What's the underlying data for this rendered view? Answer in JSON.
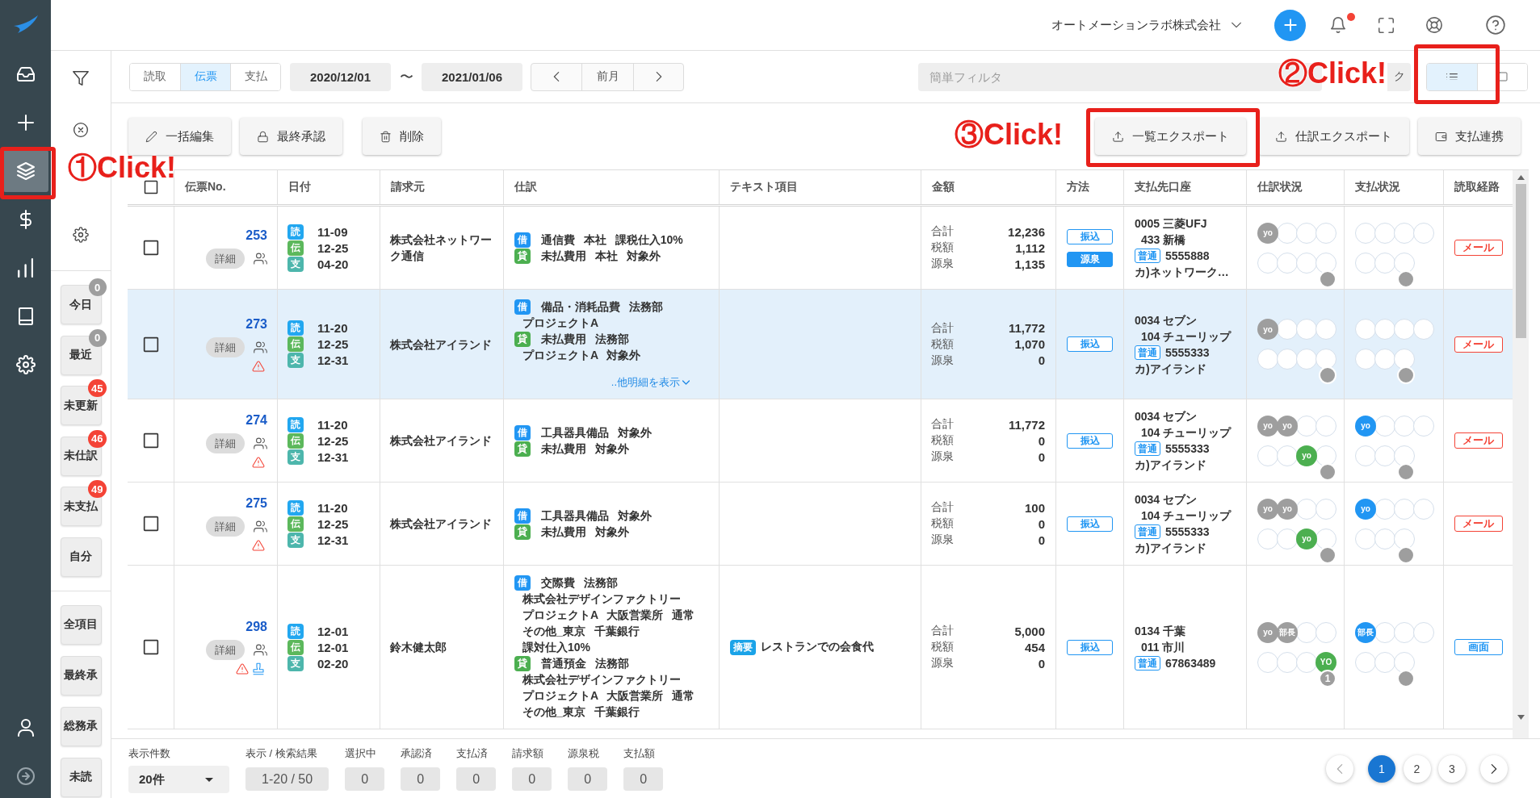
{
  "app_rail": {
    "items": [
      {
        "selected": false
      },
      {
        "selected": false
      },
      {
        "selected": true
      },
      {
        "selected": false
      },
      {
        "selected": false
      },
      {
        "selected": false
      },
      {
        "selected": false
      }
    ]
  },
  "header": {
    "company": "オートメーションラボ株式会社",
    "notifications_unread": true
  },
  "filter_panel": {
    "quick_filters": [
      {
        "label": "今日",
        "badge": {
          "text": "0",
          "color": "#9e9e9e"
        }
      },
      {
        "label": "最近",
        "badge": {
          "text": "0",
          "color": "#9e9e9e"
        }
      },
      {
        "label": "未更新",
        "badge": {
          "text": "45",
          "color": "#f44336"
        }
      },
      {
        "label": "未仕訳",
        "badge": {
          "text": "46",
          "color": "#f44336"
        }
      },
      {
        "label": "未支払",
        "badge": {
          "text": "49",
          "color": "#f44336"
        }
      },
      {
        "label": "自分"
      }
    ],
    "views": [
      {
        "label": "全項目"
      },
      {
        "label": "最終承"
      },
      {
        "label": "総務承"
      },
      {
        "label": "未読"
      }
    ]
  },
  "toolbar": {
    "source_tabs": [
      {
        "label": "読取",
        "selected": false
      },
      {
        "label": "伝票",
        "selected": true
      },
      {
        "label": "支払",
        "selected": false
      }
    ],
    "date_from": "2020/12/01",
    "date_separator": "〜",
    "date_to": "2021/01/06",
    "period_label": "前月",
    "quick_filter": {
      "placeholder": "簡単フィルタ"
    },
    "covered_box": {
      "text": "ク"
    },
    "view_toggle": [
      {
        "selected": true
      },
      {
        "selected": false
      }
    ]
  },
  "actions": {
    "left": [
      {
        "label": "一括編集"
      },
      {
        "label": "最終承認"
      },
      {
        "label": "削除"
      }
    ],
    "right": [
      {
        "label": "一覧エクスポート"
      },
      {
        "label": "仕訳エクスポート"
      },
      {
        "label": "支払連携"
      }
    ]
  },
  "table": {
    "select_all": {
      "checked": false
    },
    "columns": [
      "伝票No.",
      "日付",
      "請求元",
      "仕訳",
      "テキスト項目",
      "金額",
      "方法",
      "支払先口座",
      "仕訳状況",
      "支払状況",
      "読取経路"
    ],
    "rows": [
      {
        "highlighted": false,
        "checked": false,
        "number": "253",
        "detail": "詳細",
        "warning": false,
        "stamp": false,
        "dates": [
          {
            "tag": "読",
            "value": "11-09",
            "color": "#22a7f0"
          },
          {
            "tag": "伝",
            "value": "12-25",
            "color": "#5cb85c"
          },
          {
            "tag": "支",
            "value": "04-20",
            "color": "#4db6ac"
          }
        ],
        "payee": "株式会社ネットワーク通信",
        "journal": [
          {
            "side": "借",
            "color": "#2196f3",
            "lines": [
              "通信費 本社 課税仕入10%"
            ]
          },
          {
            "side": "貸",
            "color": "#4caf50",
            "lines": [
              "未払費用 本社 対象外"
            ]
          }
        ],
        "amounts": [
          {
            "label": "合計",
            "value": "12,236"
          },
          {
            "label": "税額",
            "value": "1,112"
          },
          {
            "label": "源泉",
            "value": "1,135"
          }
        ],
        "methods": [
          {
            "label": "振込",
            "kind": "outline"
          },
          {
            "label": "源泉",
            "kind": "filled"
          }
        ],
        "account": {
          "bank": "0005 三菱UFJ",
          "branch": "433 新橋",
          "type": "普通",
          "number": "5555888",
          "holder": "カ)ネットワーク…"
        },
        "journal_status": {
          "top": [
            {
              "kind": "user",
              "label": "yo",
              "color": "#9e9e9e"
            },
            {
              "kind": "empty"
            },
            {
              "kind": "empty"
            },
            {
              "kind": "empty"
            }
          ],
          "bottom": [
            {
              "kind": "empty"
            },
            {
              "kind": "empty"
            },
            {
              "kind": "empty"
            },
            {
              "kind": "empty"
            }
          ]
        },
        "payment_status": {
          "top": [
            {
              "kind": "empty"
            },
            {
              "kind": "empty"
            },
            {
              "kind": "empty"
            },
            {
              "kind": "empty"
            }
          ],
          "bottom": [
            {
              "kind": "empty"
            },
            {
              "kind": "empty"
            },
            {
              "kind": "empty"
            }
          ]
        },
        "source": {
          "label": "メール",
          "color": "#f44336"
        }
      },
      {
        "highlighted": true,
        "checked": false,
        "number": "273",
        "detail": "詳細",
        "warning": true,
        "stamp": false,
        "dates": [
          {
            "tag": "読",
            "value": "11-20",
            "color": "#22a7f0"
          },
          {
            "tag": "伝",
            "value": "12-25",
            "color": "#5cb85c"
          },
          {
            "tag": "支",
            "value": "12-31",
            "color": "#4db6ac"
          }
        ],
        "payee": "株式会社アイランド",
        "journal": [
          {
            "side": "借",
            "color": "#2196f3",
            "lines": [
              "備品・消耗品費 法務部",
              "プロジェクトA"
            ]
          },
          {
            "side": "貸",
            "color": "#4caf50",
            "lines": [
              "未払費用 法務部",
              "プロジェクトA 対象外"
            ]
          }
        ],
        "more_link": "..他明細を表示",
        "amounts": [
          {
            "label": "合計",
            "value": "11,772"
          },
          {
            "label": "税額",
            "value": "1,070"
          },
          {
            "label": "源泉",
            "value": "0"
          }
        ],
        "methods": [
          {
            "label": "振込",
            "kind": "outline"
          }
        ],
        "account": {
          "bank": "0034 セブン",
          "branch": "104 チューリップ",
          "type": "普通",
          "number": "5555333",
          "holder": "カ)アイランド"
        },
        "journal_status": {
          "top": [
            {
              "kind": "user",
              "label": "yo",
              "color": "#9e9e9e"
            },
            {
              "kind": "empty"
            },
            {
              "kind": "empty"
            },
            {
              "kind": "empty"
            }
          ],
          "bottom": [
            {
              "kind": "empty"
            },
            {
              "kind": "empty"
            },
            {
              "kind": "empty"
            },
            {
              "kind": "empty"
            }
          ]
        },
        "payment_status": {
          "top": [
            {
              "kind": "empty"
            },
            {
              "kind": "empty"
            },
            {
              "kind": "empty"
            },
            {
              "kind": "empty"
            }
          ],
          "bottom": [
            {
              "kind": "empty"
            },
            {
              "kind": "empty"
            },
            {
              "kind": "empty"
            }
          ]
        },
        "source": {
          "label": "メール",
          "color": "#f44336"
        }
      },
      {
        "highlighted": false,
        "checked": false,
        "number": "274",
        "detail": "詳細",
        "warning": true,
        "stamp": false,
        "dates": [
          {
            "tag": "読",
            "value": "11-20",
            "color": "#22a7f0"
          },
          {
            "tag": "伝",
            "value": "12-25",
            "color": "#5cb85c"
          },
          {
            "tag": "支",
            "value": "12-31",
            "color": "#4db6ac"
          }
        ],
        "payee": "株式会社アイランド",
        "journal": [
          {
            "side": "借",
            "color": "#2196f3",
            "lines": [
              "工具器具備品 対象外"
            ]
          },
          {
            "side": "貸",
            "color": "#4caf50",
            "lines": [
              "未払費用 対象外"
            ]
          }
        ],
        "amounts": [
          {
            "label": "合計",
            "value": "11,772"
          },
          {
            "label": "税額",
            "value": "0"
          },
          {
            "label": "源泉",
            "value": "0"
          }
        ],
        "methods": [
          {
            "label": "振込",
            "kind": "outline"
          }
        ],
        "account": {
          "bank": "0034 セブン",
          "branch": "104 チューリップ",
          "type": "普通",
          "number": "5555333",
          "holder": "カ)アイランド"
        },
        "journal_status": {
          "top": [
            {
              "kind": "user",
              "label": "yo",
              "color": "#9e9e9e"
            },
            {
              "kind": "user",
              "label": "yo",
              "color": "#9e9e9e"
            },
            {
              "kind": "empty"
            },
            {
              "kind": "empty"
            }
          ],
          "bottom": [
            {
              "kind": "empty"
            },
            {
              "kind": "empty"
            },
            {
              "kind": "user",
              "label": "yo",
              "color": "#4caf50"
            },
            {
              "kind": "empty"
            }
          ]
        },
        "payment_status": {
          "top": [
            {
              "kind": "user",
              "label": "yo",
              "color": "#2196f3"
            },
            {
              "kind": "empty"
            },
            {
              "kind": "empty"
            },
            {
              "kind": "empty"
            }
          ],
          "bottom": [
            {
              "kind": "empty"
            },
            {
              "kind": "empty"
            },
            {
              "kind": "empty"
            }
          ]
        },
        "source": {
          "label": "メール",
          "color": "#f44336"
        }
      },
      {
        "highlighted": false,
        "checked": false,
        "number": "275",
        "detail": "詳細",
        "warning": true,
        "stamp": false,
        "dates": [
          {
            "tag": "読",
            "value": "11-20",
            "color": "#22a7f0"
          },
          {
            "tag": "伝",
            "value": "12-25",
            "color": "#5cb85c"
          },
          {
            "tag": "支",
            "value": "12-31",
            "color": "#4db6ac"
          }
        ],
        "payee": "株式会社アイランド",
        "journal": [
          {
            "side": "借",
            "color": "#2196f3",
            "lines": [
              "工具器具備品 対象外"
            ]
          },
          {
            "side": "貸",
            "color": "#4caf50",
            "lines": [
              "未払費用 対象外"
            ]
          }
        ],
        "amounts": [
          {
            "label": "合計",
            "value": "100"
          },
          {
            "label": "税額",
            "value": "0"
          },
          {
            "label": "源泉",
            "value": "0"
          }
        ],
        "methods": [
          {
            "label": "振込",
            "kind": "outline"
          }
        ],
        "account": {
          "bank": "0034 セブン",
          "branch": "104 チューリップ",
          "type": "普通",
          "number": "5555333",
          "holder": "カ)アイランド"
        },
        "journal_status": {
          "top": [
            {
              "kind": "user",
              "label": "yo",
              "color": "#9e9e9e"
            },
            {
              "kind": "user",
              "label": "yo",
              "color": "#9e9e9e"
            },
            {
              "kind": "empty"
            },
            {
              "kind": "empty"
            }
          ],
          "bottom": [
            {
              "kind": "empty"
            },
            {
              "kind": "empty"
            },
            {
              "kind": "user",
              "label": "yo",
              "color": "#4caf50"
            },
            {
              "kind": "empty"
            }
          ]
        },
        "payment_status": {
          "top": [
            {
              "kind": "user",
              "label": "yo",
              "color": "#2196f3"
            },
            {
              "kind": "empty"
            },
            {
              "kind": "empty"
            },
            {
              "kind": "empty"
            }
          ],
          "bottom": [
            {
              "kind": "empty"
            },
            {
              "kind": "empty"
            },
            {
              "kind": "empty"
            }
          ]
        },
        "source": {
          "label": "メール",
          "color": "#f44336"
        }
      },
      {
        "highlighted": false,
        "checked": false,
        "number": "298",
        "detail": "詳細",
        "warning": true,
        "stamp": true,
        "dates": [
          {
            "tag": "読",
            "value": "12-01",
            "color": "#22a7f0"
          },
          {
            "tag": "伝",
            "value": "12-01",
            "color": "#5cb85c"
          },
          {
            "tag": "支",
            "value": "02-20",
            "color": "#4db6ac"
          }
        ],
        "payee": "鈴木健太郎",
        "journal": [
          {
            "side": "借",
            "color": "#2196f3",
            "lines": [
              "交際費 法務部",
              "株式会社デザインファクトリー",
              "プロジェクトA 大阪営業所 通常",
              "その他_東京 千葉銀行",
              "課対仕入10%"
            ]
          },
          {
            "side": "貸",
            "color": "#4caf50",
            "lines": [
              "普通預金 法務部",
              "株式会社デザインファクトリー",
              "プロジェクトA 大阪営業所 通常",
              "その他_東京 千葉銀行"
            ]
          }
        ],
        "text_item": {
          "tag": "摘要",
          "text": "レストランでの会食代"
        },
        "amounts": [
          {
            "label": "合計",
            "value": "5,000"
          },
          {
            "label": "税額",
            "value": "454"
          },
          {
            "label": "源泉",
            "value": "0"
          }
        ],
        "methods": [
          {
            "label": "振込",
            "kind": "outline"
          }
        ],
        "account": {
          "bank": "0134 千葉",
          "branch": "011 市川",
          "type": "普通",
          "number": "67863489"
        },
        "journal_status": {
          "top": [
            {
              "kind": "user",
              "label": "yo",
              "color": "#9e9e9e"
            },
            {
              "kind": "user",
              "label": "部長",
              "color": "#9e9e9e"
            },
            {
              "kind": "empty"
            },
            {
              "kind": "empty"
            }
          ],
          "bottom": [
            {
              "kind": "empty"
            },
            {
              "kind": "empty"
            },
            {
              "kind": "empty"
            },
            {
              "kind": "user",
              "label": "YO",
              "color": "#4caf50"
            }
          ],
          "marker_text": "1"
        },
        "payment_status": {
          "top": [
            {
              "kind": "user",
              "label": "部長",
              "color": "#2196f3"
            },
            {
              "kind": "empty"
            },
            {
              "kind": "empty"
            },
            {
              "kind": "empty"
            }
          ],
          "bottom": [
            {
              "kind": "empty"
            },
            {
              "kind": "empty"
            },
            {
              "kind": "empty"
            }
          ]
        },
        "source": {
          "label": "画面",
          "color": "#2196f3"
        }
      }
    ]
  },
  "footer": {
    "page_size": {
      "label": "表示件数",
      "value": "20件"
    },
    "stats": [
      {
        "label": "表示 / 検索結果",
        "value": "1-20 / 50"
      },
      {
        "label": "選択中",
        "value": "0"
      },
      {
        "label": "承認済",
        "value": "0"
      },
      {
        "label": "支払済",
        "value": "0"
      },
      {
        "label": "請求額",
        "value": "0"
      },
      {
        "label": "源泉税",
        "value": "0"
      },
      {
        "label": "支払額",
        "value": "0"
      }
    ],
    "pagination": {
      "prev_disabled": true,
      "next_disabled": false,
      "pages": [
        {
          "label": "1",
          "selected": true
        },
        {
          "label": "2",
          "selected": false
        },
        {
          "label": "3",
          "selected": false
        }
      ]
    }
  },
  "annotations": [
    {
      "text": "①Click!"
    },
    {
      "text": "②Click!"
    },
    {
      "text": "③Click!"
    }
  ]
}
